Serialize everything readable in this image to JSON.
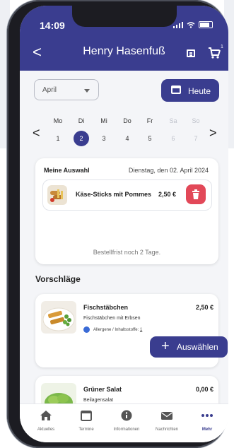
{
  "status_bar": {
    "time": "14:09"
  },
  "header": {
    "title": "Henry Hasenfuß",
    "back_label": "<",
    "cart_badge": "1"
  },
  "controls": {
    "month": "April",
    "today_button": "Heute"
  },
  "week": {
    "days": [
      {
        "name": "Mo",
        "num": "1",
        "state": "normal"
      },
      {
        "name": "Di",
        "num": "2",
        "state": "selected"
      },
      {
        "name": "Mi",
        "num": "3",
        "state": "normal"
      },
      {
        "name": "Do",
        "num": "4",
        "state": "normal"
      },
      {
        "name": "Fr",
        "num": "5",
        "state": "normal"
      },
      {
        "name": "Sa",
        "num": "6",
        "state": "muted"
      },
      {
        "name": "So",
        "num": "7",
        "state": "muted"
      }
    ],
    "prev": "<",
    "next": ">"
  },
  "selection": {
    "heading": "Meine Auswahl",
    "date": "Dienstag, den 02. April 2024",
    "item": {
      "name": "Käse-Sticks mit Pommes",
      "price": "2,50 €"
    },
    "deadline": "Bestellfrist noch 2 Tage."
  },
  "suggestions": {
    "heading": "Vorschläge",
    "items": [
      {
        "name": "Fischstäbchen",
        "description": "Fischstäbchen mit Erbsen",
        "allergen_label": "Allergene / Inhaltsstoffe:",
        "allergen_value": "1",
        "price": "2,50 €",
        "button": "Auswählen"
      },
      {
        "name": "Grüner Salat",
        "description": "Beilagensalat",
        "price": "0,00 €"
      }
    ]
  },
  "tabbar": {
    "items": [
      {
        "label": "Aktuelles",
        "icon": "home-icon"
      },
      {
        "label": "Termine",
        "icon": "calendar-icon"
      },
      {
        "label": "Informationen",
        "icon": "info-icon"
      },
      {
        "label": "Nachrichten",
        "icon": "mail-icon"
      },
      {
        "label": "Mehr",
        "icon": "more-icon",
        "active": true
      }
    ]
  },
  "colors": {
    "primary": "#3a3d8f",
    "delete": "#e24858",
    "background": "#f4f5f8"
  }
}
